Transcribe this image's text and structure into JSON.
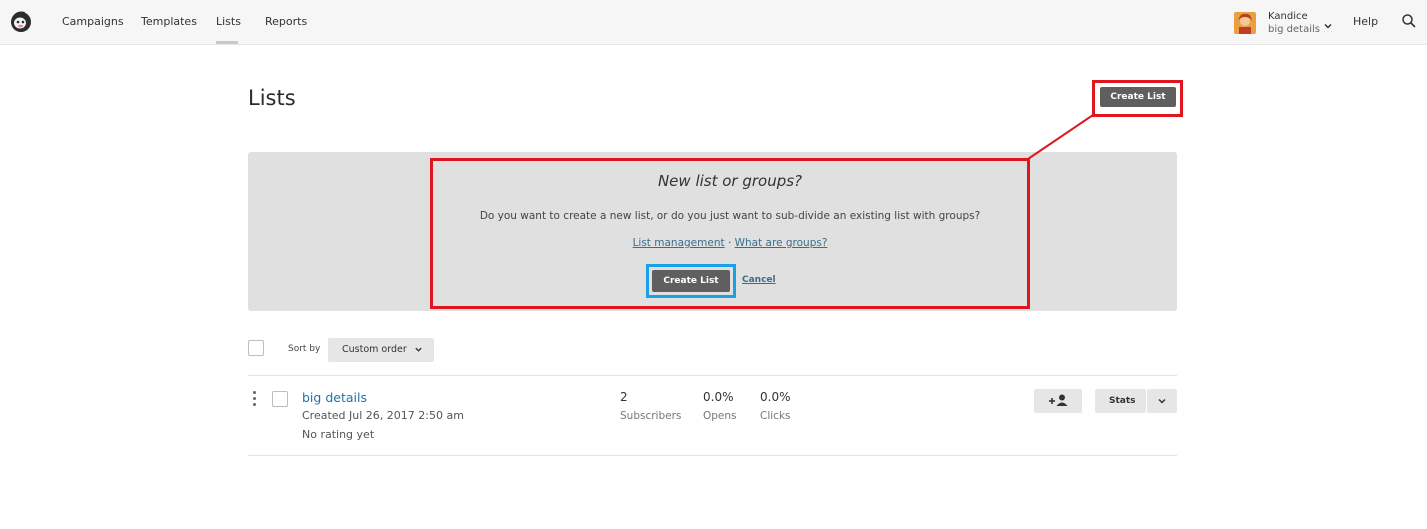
{
  "nav": {
    "items": [
      "Campaigns",
      "Templates",
      "Lists",
      "Reports"
    ],
    "active": "Lists",
    "user_name": "Kandice",
    "user_account": "big details",
    "help": "Help"
  },
  "page": {
    "title": "Lists",
    "create_button": "Create List"
  },
  "callout": {
    "title": "New list or groups?",
    "text": "Do you want to create a new list, or do you just want to sub-divide an existing list with groups?",
    "link_management": "List management",
    "separator": "·",
    "link_groups": "What are groups?",
    "create_button": "Create List",
    "cancel": "Cancel"
  },
  "toolbar": {
    "sort_label": "Sort by",
    "sort_value": "Custom order"
  },
  "lists": [
    {
      "name": "big details",
      "created": "Created Jul 26, 2017 2:50 am",
      "rating": "No rating yet",
      "subscribers_value": "2",
      "subscribers_label": "Subscribers",
      "opens_value": "0.0%",
      "opens_label": "Opens",
      "clicks_value": "0.0%",
      "clicks_label": "Clicks",
      "stats_button": "Stats"
    }
  ],
  "colors": {
    "highlight_red": "#e0161f",
    "highlight_blue": "#1aa0e6",
    "link": "#1e74a8",
    "button_dark": "#5f5f5f"
  },
  "icons": [
    "mailchimp-logo-icon",
    "avatar",
    "chevron-down-icon",
    "search-icon",
    "add-contact-icon",
    "kebab-menu-icon"
  ]
}
